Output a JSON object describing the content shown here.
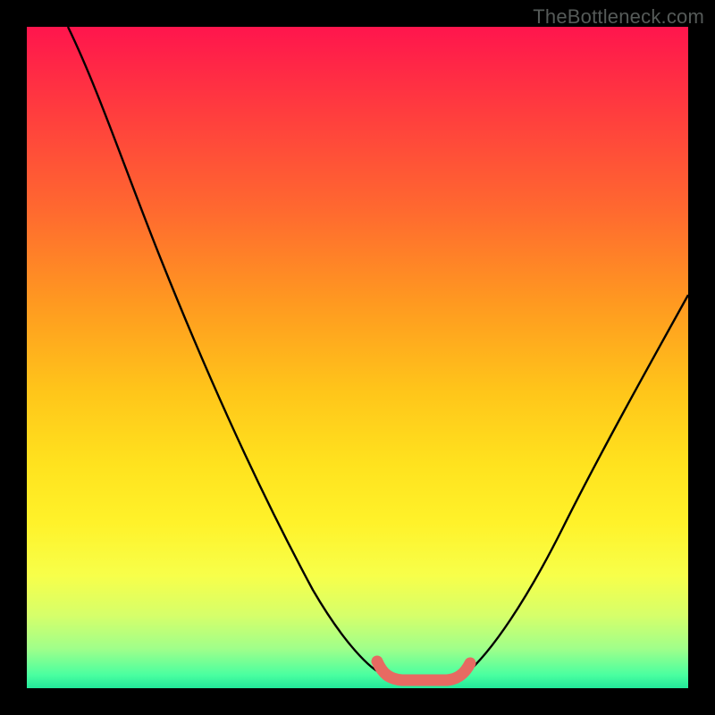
{
  "watermark": "TheBottleneck.com",
  "chart_data": {
    "type": "line",
    "title": "",
    "xlabel": "",
    "ylabel": "",
    "xlim": [
      0,
      100
    ],
    "ylim": [
      0,
      100
    ],
    "series": [
      {
        "name": "curve-left",
        "color": "#000000",
        "x": [
          6,
          10,
          16,
          22,
          30,
          38,
          44,
          50,
          54
        ],
        "values": [
          100,
          88,
          74,
          62,
          46,
          30,
          18,
          8,
          3
        ]
      },
      {
        "name": "curve-right",
        "color": "#000000",
        "x": [
          66,
          70,
          76,
          82,
          88,
          94,
          100
        ],
        "values": [
          3,
          8,
          18,
          30,
          42,
          52,
          60
        ]
      },
      {
        "name": "trough-highlight",
        "color": "#e76a62",
        "x": [
          53,
          55,
          58,
          62,
          64,
          66,
          67
        ],
        "values": [
          4,
          2,
          1,
          1,
          2,
          3,
          5
        ]
      }
    ],
    "background": "rainbow-gradient-red-to-green",
    "grid": false,
    "legend": false
  }
}
